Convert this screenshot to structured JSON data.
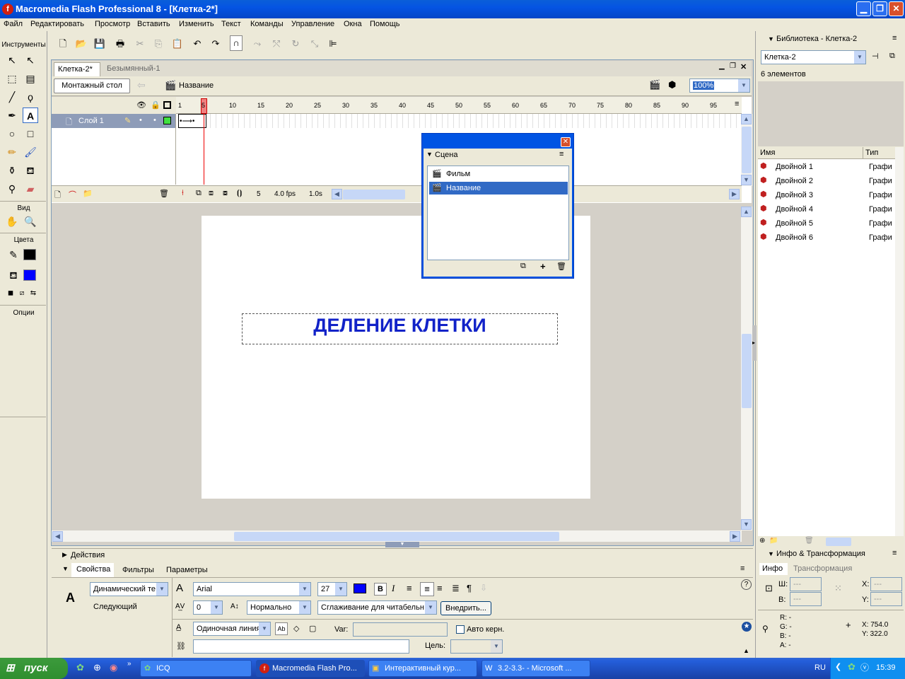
{
  "window": {
    "title": "Macromedia Flash Professional 8 - [Клетка-2*]",
    "minimize": "▁",
    "restore": "❐",
    "close": "✕"
  },
  "menu": [
    "Файл",
    "Редактировать",
    "Просмотр",
    "Вставить",
    "Изменить",
    "Текст",
    "Команды",
    "Управление",
    "Окна",
    "Помощь"
  ],
  "tools": {
    "title": "Инструменты",
    "view_label": "Вид",
    "colors_label": "Цвета",
    "options_label": "Опции"
  },
  "doc_tabs": [
    {
      "label": "Клетка-2*",
      "active": true
    },
    {
      "label": "Безымянный-1",
      "active": false
    }
  ],
  "edit_bar": {
    "timeline_btn": "Монтажный стол",
    "scene_name": "Название",
    "zoom": "100%"
  },
  "timeline": {
    "layer_name": "Слой 1",
    "ruler": [
      "1",
      "5",
      "10",
      "15",
      "20",
      "25",
      "30",
      "35",
      "40",
      "45",
      "50",
      "55",
      "60",
      "65",
      "70",
      "75",
      "80",
      "85",
      "90",
      "95"
    ],
    "current_frame": "5",
    "fps": "4.0 fps",
    "time": "1.0s"
  },
  "stage": {
    "text": "ДЕЛЕНИЕ КЛЕТКИ",
    "text_color": "#1122c8"
  },
  "scene_panel": {
    "title": "Сцена",
    "items": [
      {
        "label": "Фильм",
        "selected": false
      },
      {
        "label": "Название",
        "selected": true
      }
    ]
  },
  "actions_panel": {
    "title": "Действия"
  },
  "props": {
    "tabs": [
      "Свойства",
      "Фильтры",
      "Параметры"
    ],
    "text_type": "Динамический те",
    "instance": "Следующий",
    "font": "Arial",
    "size": "27",
    "spacing": "0",
    "position": "Нормально",
    "antialias": "Сглаживание для читабельн",
    "embed_btn": "Внедрить...",
    "line_type": "Одиночная линия",
    "var_label": "Var:",
    "var_value": "",
    "autokern_label": "Авто керн.",
    "link_value": "",
    "target_label": "Цель:"
  },
  "library": {
    "title": "Библиотека - Клетка-2",
    "doc": "Клетка-2",
    "count": "6 элементов",
    "col_name": "Имя",
    "col_type": "Тип",
    "items": [
      {
        "name": "Двойной 1",
        "type": "Графи"
      },
      {
        "name": "Двойной 2",
        "type": "Графи"
      },
      {
        "name": "Двойной 3",
        "type": "Графи"
      },
      {
        "name": "Двойной 4",
        "type": "Графи"
      },
      {
        "name": "Двойной 5",
        "type": "Графи"
      },
      {
        "name": "Двойной 6",
        "type": "Графи"
      }
    ]
  },
  "info": {
    "title": "Инфо & Трансформация",
    "tab_info": "Инфо",
    "tab_transform": "Трансформация",
    "w_label": "Ш:",
    "h_label": "В:",
    "w_value": "---",
    "h_value": "---",
    "x_label": "X:",
    "y_label": "Y:",
    "x_value": "---",
    "y_value": "---",
    "r": "R: -",
    "g": "G: -",
    "b": "B: -",
    "a": "A: -",
    "cx": "X:  754.0",
    "cy": "Y:  322.0"
  },
  "taskbar": {
    "start": "пуск",
    "tasks": [
      "ICQ",
      "Macromedia Flash Pro...",
      "Интерактивный кур...",
      "3.2-3.3- - Microsoft ..."
    ],
    "lang": "RU",
    "clock": "15:39"
  }
}
